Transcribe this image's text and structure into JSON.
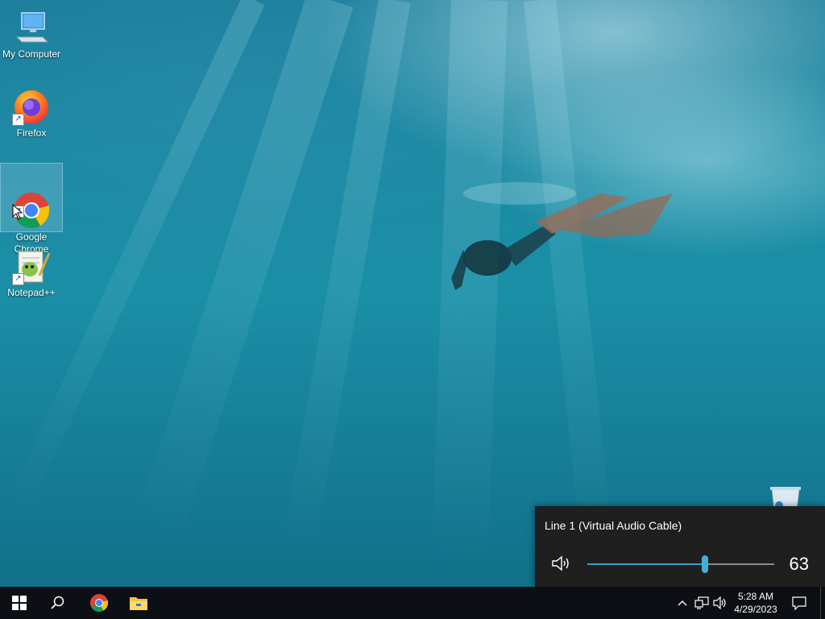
{
  "desktop": {
    "icons": [
      {
        "label": "My Computer",
        "icon": "computer-icon"
      },
      {
        "label": "Firefox",
        "icon": "firefox-icon"
      },
      {
        "label": "Google\nChrome",
        "icon": "chrome-icon"
      },
      {
        "label": "Notepad++",
        "icon": "notepadpp-icon"
      }
    ],
    "recycle_bin": {
      "icon": "recycle-bin-icon"
    }
  },
  "volume_flyout": {
    "device_name": "Line 1 (Virtual Audio Cable)",
    "volume": "63",
    "volume_fraction": 0.63,
    "speaker_icon": "speaker-icon",
    "accent_color": "#3fb0d4"
  },
  "taskbar": {
    "start_icon": "windows-start-icon",
    "search_icon": "search-icon",
    "pinned": [
      {
        "name": "Google Chrome",
        "icon": "chrome-icon"
      },
      {
        "name": "File Explorer",
        "icon": "folder-icon"
      }
    ],
    "tray": {
      "chevron_icon": "chevron-up-icon",
      "network_icon": "network-icon",
      "volume_icon": "volume-icon"
    },
    "clock": {
      "time": "5:28 AM",
      "date": "4/29/2023"
    },
    "notification_icon": "notification-icon"
  }
}
